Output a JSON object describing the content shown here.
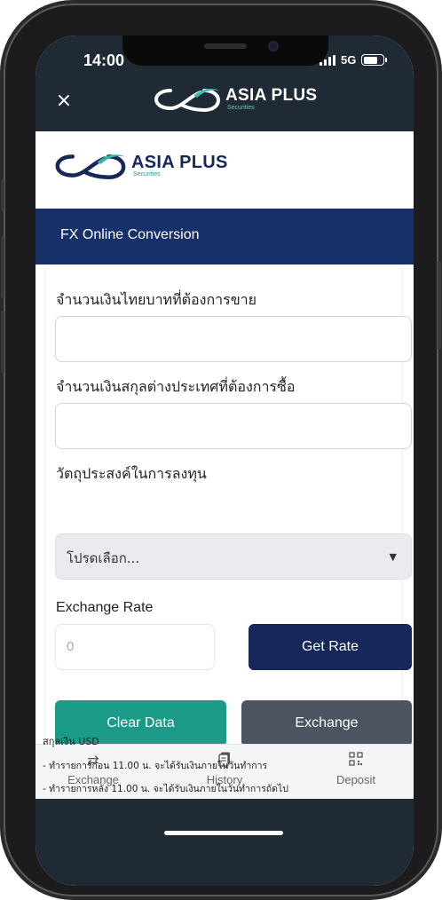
{
  "status_bar": {
    "time": "14:00",
    "network": "5G"
  },
  "nav": {
    "close_label": "×",
    "brand": "ASIA PLUS",
    "brand_sub": "Securities"
  },
  "header": {
    "brand": "ASIA PLUS",
    "brand_sub": "Securities",
    "title": "FX Online Conversion"
  },
  "form": {
    "thb_amount_label": "จำนวนเงินไทยบาทที่ต้องการขาย",
    "thb_amount_value": "",
    "fx_amount_label": "จำนวนเงินสกุลต่างประเทศที่ต้องการซื้อ",
    "fx_amount_value": "",
    "purpose_label": "วัตถุประสงค์ในการลงทุน",
    "purpose_value": "โปรดเลือก...",
    "rate_label": "Exchange Rate",
    "rate_value": "0",
    "get_rate_label": "Get Rate",
    "clear_label": "Clear Data",
    "exchange_label": "Exchange"
  },
  "notes": [
    "สกุลเงิน USD",
    "- ทำรายการก่อน 11.00 น. จะได้รับเงินภายในวันทำการ",
    "- ทำรายการหลัง 11.00 น. จะได้รับเงินภายในวันทำการถัดไป"
  ],
  "tabs": [
    {
      "label": "Exchange",
      "icon": "exchange-arrows-icon"
    },
    {
      "label": "History",
      "icon": "history-document-icon"
    },
    {
      "label": "Deposit",
      "icon": "qr-code-icon"
    }
  ],
  "colors": {
    "nav_bg": "#1f2a35",
    "title_bar": "#17306a",
    "get_rate": "#16275a",
    "clear_data": "#1c9a88",
    "exchange_button": "#4b5460"
  }
}
